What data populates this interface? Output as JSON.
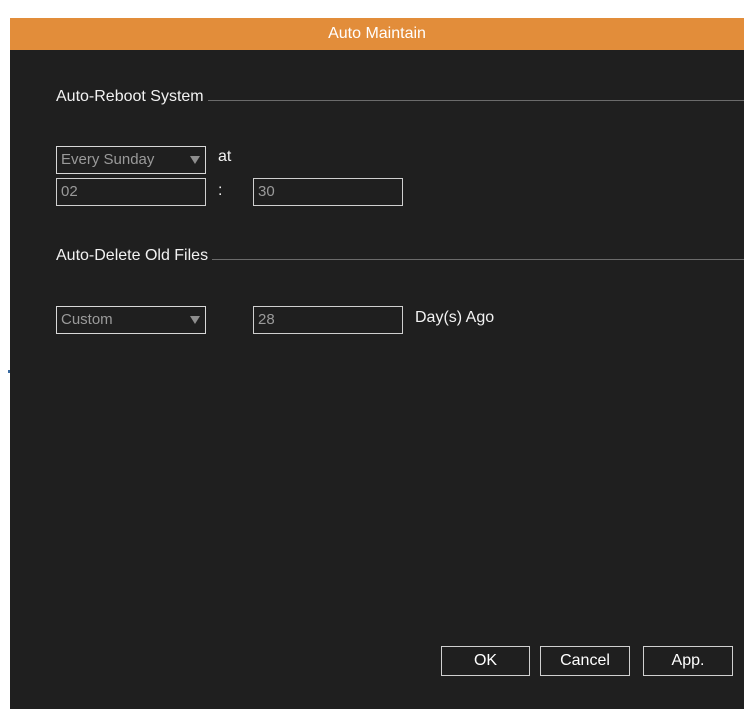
{
  "window": {
    "title": "Auto Maintain"
  },
  "reboot": {
    "section_title": "Auto-Reboot System",
    "schedule_value": "Every Sunday",
    "at_label": "at",
    "hour_value": "02",
    "time_separator": ":",
    "minute_value": "30"
  },
  "delete": {
    "section_title": "Auto-Delete Old Files",
    "mode_value": "Custom",
    "days_value": "28",
    "days_suffix": "Day(s) Ago"
  },
  "buttons": {
    "ok": "OK",
    "cancel": "Cancel",
    "apply": "App."
  },
  "colors": {
    "title_bar": "#e28d3a",
    "background": "#1f1f1f",
    "text": "#f2f2f2"
  }
}
